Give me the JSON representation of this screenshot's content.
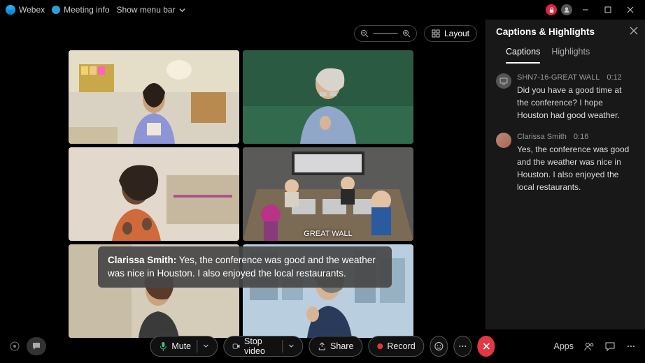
{
  "titlebar": {
    "app_name": "Webex",
    "meeting_info": "Meeting info",
    "menu_label": "Show menu bar"
  },
  "stage": {
    "layout_label": "Layout",
    "room_label": "GREAT WALL"
  },
  "caption_overlay": {
    "speaker": "Clarissa Smith:",
    "text": " Yes, the conference was good and the weather was nice in Houston. I also enjoyed the local restaurants."
  },
  "panel": {
    "title": "Captions & Highlights",
    "tabs": {
      "captions": "Captions",
      "highlights": "Highlights"
    },
    "items": [
      {
        "name": "SHN7-16-GREAT WALL",
        "time": "0:12",
        "text": "Did you have a good time at the conference? I hope Houston had good weather.",
        "avatar": "device"
      },
      {
        "name": "Clarissa Smith",
        "time": "0:16",
        "text": "Yes, the conference was good and the weather was nice in Houston. I also enjoyed the local restaurants.",
        "avatar": "person"
      }
    ]
  },
  "footer": {
    "mute": "Mute",
    "stop_video": "Stop video",
    "share": "Share",
    "record": "Record",
    "apps": "Apps"
  }
}
